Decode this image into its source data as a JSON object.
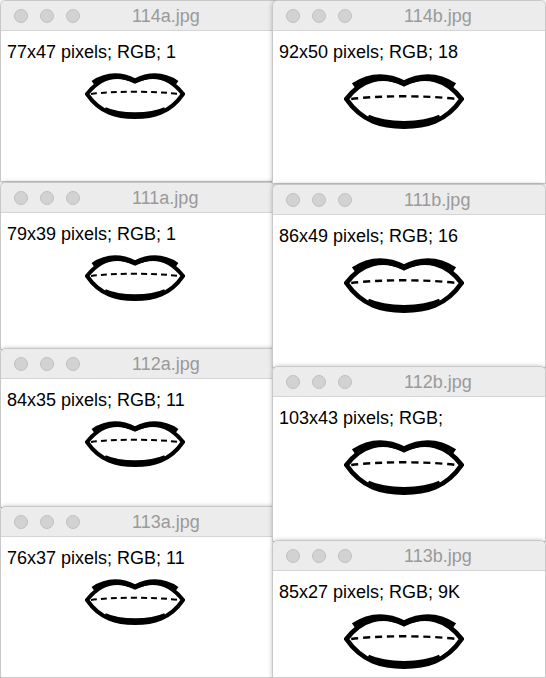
{
  "windows": [
    {
      "title": "114a.jpg",
      "info": "77x47 pixels; RGB; 1",
      "column": "left"
    },
    {
      "title": "114b.jpg",
      "info": "92x50 pixels; RGB; 18",
      "column": "right"
    },
    {
      "title": "111a.jpg",
      "info": "79x39 pixels; RGB; 1",
      "column": "left"
    },
    {
      "title": "111b.jpg",
      "info": "86x49 pixels; RGB; 16",
      "column": "right"
    },
    {
      "title": "112a.jpg",
      "info": "84x35 pixels; RGB; 11",
      "column": "left"
    },
    {
      "title": "112b.jpg",
      "info": "103x43 pixels; RGB; ",
      "column": "right"
    },
    {
      "title": "113a.jpg",
      "info": "76x37 pixels; RGB; 11",
      "column": "left"
    },
    {
      "title": "113b.jpg",
      "info": "85x27 pixels; RGB; 9K",
      "column": "right"
    }
  ]
}
